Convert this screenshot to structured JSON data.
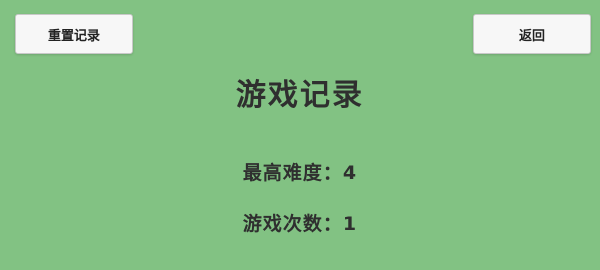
{
  "theme": {
    "background": "#82c283",
    "button_bg": "#f7f7f7",
    "text": "#2f2f2f"
  },
  "header": {
    "reset_label": "重置记录",
    "back_label": "返回"
  },
  "main": {
    "title": "游戏记录",
    "stats": [
      {
        "label": "最高难度：",
        "value": "4"
      },
      {
        "label": "游戏次数：",
        "value": "1"
      }
    ]
  }
}
